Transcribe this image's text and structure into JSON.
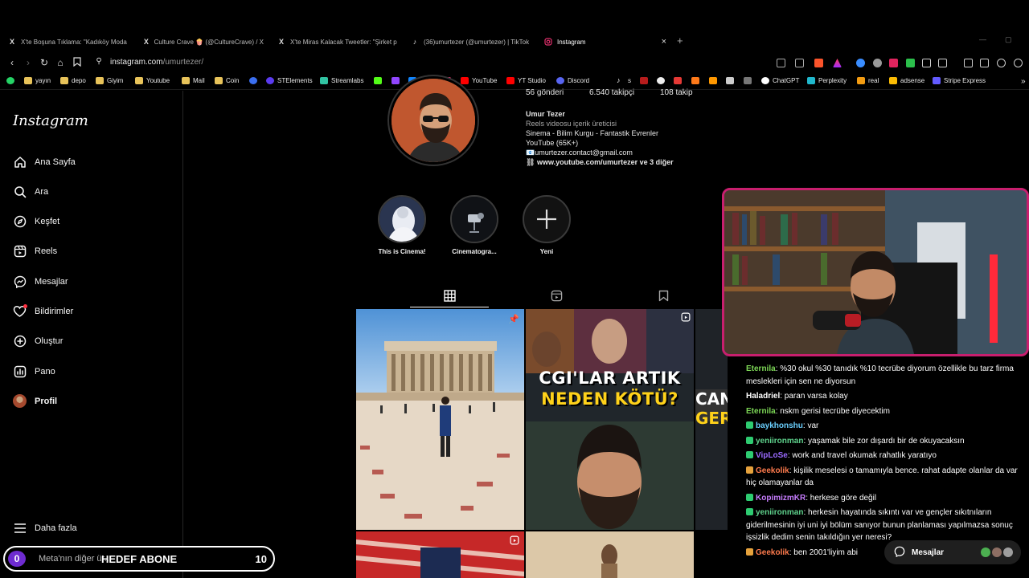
{
  "browser": {
    "tabs": [
      {
        "label": "X'te Boşuna Tıklama: \"Kadıköy Moda",
        "icon": "x-logo-icon"
      },
      {
        "label": "Culture Crave 🍿 (@CultureCrave) / X",
        "icon": "x-logo-icon"
      },
      {
        "label": "X'te Miras Kalacak Tweetler: \"Şirket p",
        "icon": "x-logo-icon"
      },
      {
        "label": "(36)umurtezer (@umurtezer) | TikTok",
        "icon": "tiktok-icon"
      },
      {
        "label": "Instagram",
        "icon": "instagram-icon",
        "active": true
      }
    ],
    "url_host": "instagram.com",
    "url_path": "/umurtezer/",
    "bookmarks": [
      "yayın",
      "depo",
      "Giyim",
      "Youtube",
      "Mail",
      "Coin",
      "STElements",
      "Streamlabs",
      "YouTube",
      "YT Studio",
      "Discord",
      "s",
      "ChatGPT",
      "Perplexity",
      "real",
      "adsense",
      "Stripe Express"
    ]
  },
  "sidebar": {
    "logo": "Instagram",
    "items": [
      {
        "label": "Ana Sayfa",
        "icon": "home-icon"
      },
      {
        "label": "Ara",
        "icon": "search-icon"
      },
      {
        "label": "Keşfet",
        "icon": "compass-icon"
      },
      {
        "label": "Reels",
        "icon": "reels-icon"
      },
      {
        "label": "Mesajlar",
        "icon": "messenger-icon"
      },
      {
        "label": "Bildirimler",
        "icon": "heart-icon"
      },
      {
        "label": "Oluştur",
        "icon": "plus-square-icon"
      },
      {
        "label": "Pano",
        "icon": "dashboard-icon"
      },
      {
        "label": "Profil",
        "icon": "avatar"
      }
    ],
    "more": "Daha fazla",
    "meta": "Meta'nın diğer ür..."
  },
  "profile": {
    "stats": [
      "56 gönderi",
      "6.540 takipçi",
      "108 takip"
    ],
    "name": "Umur Tezer",
    "category": "Reels videosu içerik üreticisi",
    "bio_line1": "Sinema - Bilim Kurgu - Fantastik Evrenler",
    "bio_line2": "YouTube (65K+)",
    "email": "📧umurtezer.contact@gmail.com",
    "link": "www.youtube.com/umurtezer ve 3 diğer",
    "highlights": [
      "This is Cinema!",
      "Cinematogra...",
      "Yeni"
    ]
  },
  "posts": {
    "thumb2_line1": "CGI'LAR ARTIK",
    "thumb2_line2": "NEDEN KÖTÜ?",
    "thumb3_line1": "CANDALE",
    "thumb3_line2": "GERİ DÖNDÜ:"
  },
  "chat": [
    {
      "user": "Eternila",
      "color": "#7ed957",
      "text": ": %30 okul %30 tanıdık %10 tecrübe diyorum özellikle bu tarz firma meslekleri için sen ne diyorsun",
      "badge": ""
    },
    {
      "user": "Haladriel",
      "color": "#ffffff",
      "text": ": paran varsa kolay",
      "badge": ""
    },
    {
      "user": "Eternila",
      "color": "#7ed957",
      "text": ": nskm gerisi tecrübe diyecektim",
      "badge": ""
    },
    {
      "user": "baykhonshu",
      "color": "#6ad0ff",
      "text": ": var",
      "badge": "#2ecc71"
    },
    {
      "user": "yeniironman",
      "color": "#5fd38d",
      "text": ": yaşamak bile zor dışardı bir de okuyacaksın",
      "badge": "#2ecc71"
    },
    {
      "user": "VipLoSe",
      "color": "#9b6bff",
      "text": ": work and travel okumak rahatlık yaratıyo",
      "badge": "#2ecc71"
    },
    {
      "user": "Geekolik",
      "color": "#ff7b4d",
      "text": ": kişilik meselesi o tamamıyla bence. rahat adapte olanlar da var hiç olamayanlar da",
      "badge": "#e6a23c"
    },
    {
      "user": "KopimizmKR",
      "color": "#c77dff",
      "text": ": herkese göre değil",
      "badge": "#2ecc71"
    },
    {
      "user": "yeniironman",
      "color": "#5fd38d",
      "text": ": herkesin hayatında sıkıntı var ve gençler sıkıtnıların giderilmesinin iyi uni iyi bölüm sanıyor bunun planlaması yapılmazsa sonuç işsizlik dedim senin takıldığın yer neresi?",
      "badge": "#2ecc71"
    },
    {
      "user": "Geekolik",
      "color": "#ff7b4d",
      "text": ": ben 2001'liyim abi",
      "badge": "#e6a23c"
    }
  ],
  "goal": {
    "current": "0",
    "title": "HEDEF ABONE",
    "target": "10"
  },
  "messages_pill": "Mesajlar"
}
